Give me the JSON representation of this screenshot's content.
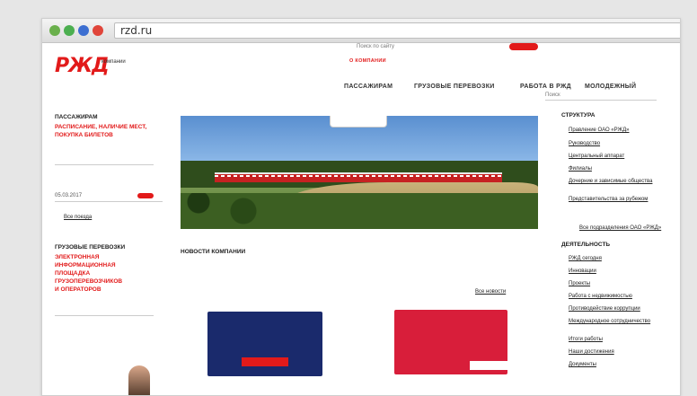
{
  "browser": {
    "url": "rzd.ru",
    "dots": [
      "#6ab04c",
      "#4caf50",
      "#3d6fd1",
      "#e0453a"
    ]
  },
  "logo": {
    "mark": "РЖД",
    "subtitle": "компании"
  },
  "top_bar": {
    "search_hint": "Поиск по сайту",
    "pill": "",
    "links": [
      "",
      "",
      ""
    ]
  },
  "nav": {
    "items": [
      "ПАССАЖИРАМ",
      "ГРУЗОВЫЕ ПЕРЕВОЗКИ",
      "РАБОТА В РЖД",
      "МОЛОДЕЖНЫЙ"
    ],
    "active_label": "О КОМПАНИИ",
    "search_label": "Поиск"
  },
  "left": {
    "passengers_heading": "ПАССАЖИРАМ",
    "passengers_link": "РАСПИСАНИЕ, НАЛИЧИЕ МЕСТ, ПОКУПКА БИЛЕТОВ",
    "date_value": "05.03.2017",
    "more_link": "Все поезда",
    "cargo_heading": "ГРУЗОВЫЕ ПЕРЕВОЗКИ",
    "cargo_link": "ЭЛЕКТРОННАЯ ИНФОРМАЦИОННАЯ ПЛОЩАДКА ГРУЗОПЕРЕВОЗЧИКОВ И ОПЕРАТОРОВ"
  },
  "news": {
    "heading": "НОВОСТИ КОМПАНИИ",
    "items": [
      {
        "date": "",
        "text": ""
      },
      {
        "date": "",
        "text": ""
      }
    ],
    "all_link": "Все новости"
  },
  "right": {
    "structure_heading": "СТРУКТУРА",
    "structure_links": [
      "Правление ОАО «РЖД»",
      "Руководство",
      "Центральный аппарат",
      "Филиалы",
      "Дочерние и зависимые общества",
      "Представительства за рубежом"
    ],
    "structure_more": "Все подразделения ОАО «РЖД»",
    "activity_heading": "ДЕЯТЕЛЬНОСТЬ",
    "activity_links": [
      "РЖД сегодня",
      "Инновации",
      "Проекты",
      "Работа с недвижимостью",
      "Противодействие коррупции",
      "Международное сотрудничество",
      "Итоги работы",
      "Наши достижения",
      "Документы"
    ]
  },
  "promos": [
    {
      "lines": [
        "",
        "",
        ""
      ],
      "button": "",
      "bg": "#1a2a6c"
    },
    {
      "lines": [
        "",
        "",
        "",
        "",
        ""
      ],
      "button": "",
      "bg": "#d81e3a"
    }
  ]
}
